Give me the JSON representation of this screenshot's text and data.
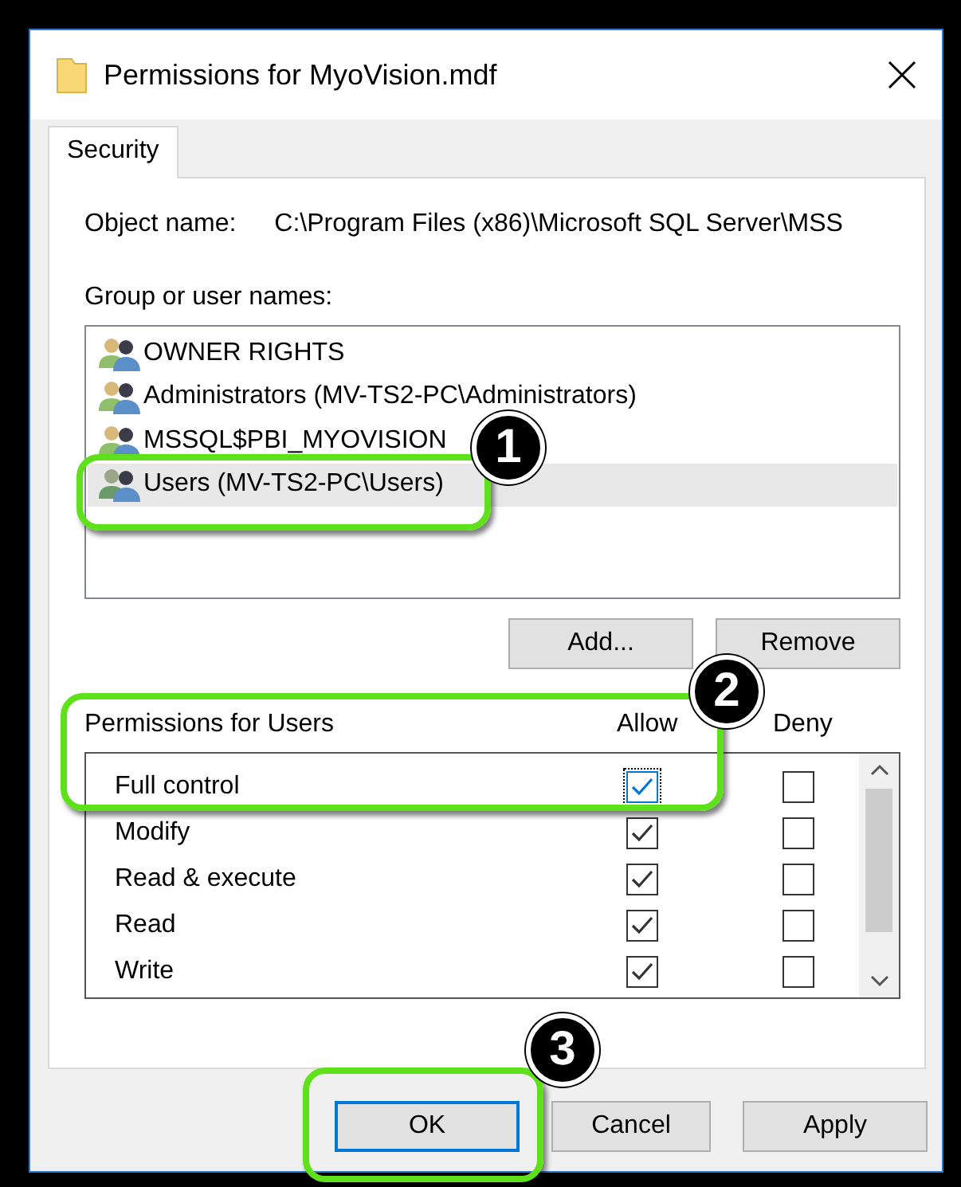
{
  "window": {
    "title": "Permissions for MyoVision.mdf"
  },
  "tabs": [
    {
      "label": "Security",
      "selected": true
    }
  ],
  "object_name": {
    "label": "Object name:",
    "value": "C:\\Program Files (x86)\\Microsoft SQL Server\\MSS"
  },
  "groups": {
    "label": "Group or user names:",
    "items": [
      {
        "name": "OWNER RIGHTS",
        "selected": false
      },
      {
        "name": "Administrators (MV-TS2-PC\\Administrators)",
        "selected": false
      },
      {
        "name": "MSSQL$PBI_MYOVISION",
        "selected": false
      },
      {
        "name": "Users (MV-TS2-PC\\Users)",
        "selected": true
      }
    ]
  },
  "group_buttons": [
    "Add...",
    "Remove"
  ],
  "permissions": {
    "title": "Permissions for Users",
    "columns": [
      "Allow",
      "Deny"
    ],
    "rows": [
      {
        "name": "Full control",
        "allow": true,
        "deny": false,
        "focused": true
      },
      {
        "name": "Modify",
        "allow": true,
        "deny": false,
        "focused": false
      },
      {
        "name": "Read & execute",
        "allow": true,
        "deny": false,
        "focused": false
      },
      {
        "name": "Read",
        "allow": true,
        "deny": false,
        "focused": false
      },
      {
        "name": "Write",
        "allow": true,
        "deny": false,
        "focused": false
      }
    ]
  },
  "buttons": [
    {
      "label": "OK",
      "default": true
    },
    {
      "label": "Cancel",
      "default": false
    },
    {
      "label": "Apply",
      "default": false
    }
  ],
  "annotations": [
    {
      "number": "1"
    },
    {
      "number": "2"
    },
    {
      "number": "3"
    }
  ]
}
